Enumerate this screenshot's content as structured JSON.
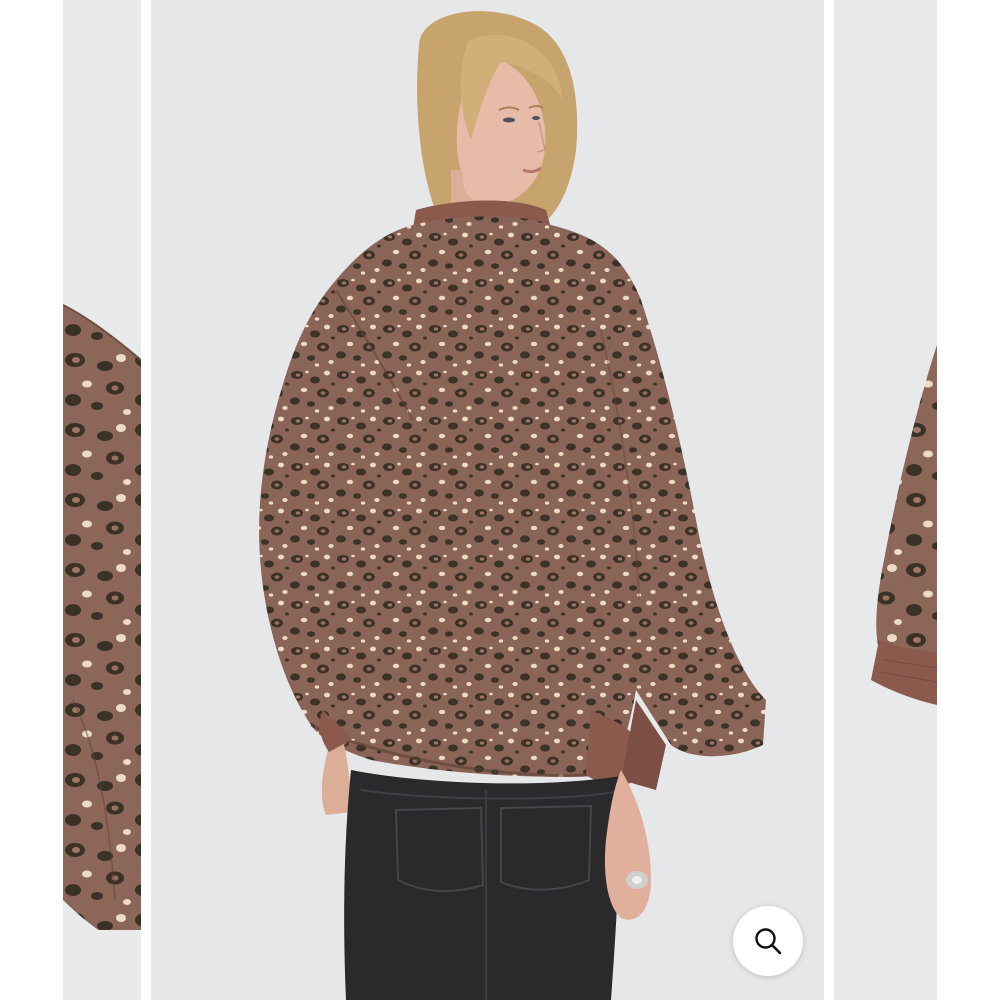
{
  "gallery": {
    "slides": [
      {
        "id": "prev",
        "subject": "leopard-print-sleeve-detail"
      },
      {
        "id": "current",
        "subject": "model-back-view-leopard-sweatshirt"
      },
      {
        "id": "next",
        "subject": "leopard-print-cuff-detail"
      }
    ],
    "zoom_button": {
      "icon": "magnifier-icon"
    }
  },
  "colors": {
    "background": "#ffffff",
    "photo_backdrop": "#e6e7e9",
    "print_base": "#8a6456",
    "print_spot": "#3b3228",
    "print_highlight": "#ecdcc6",
    "rib_trim": "#8b5a4d",
    "jeans": "#2a2a2d",
    "hair": "#c9a56f",
    "skin": "#e3b8a4"
  }
}
